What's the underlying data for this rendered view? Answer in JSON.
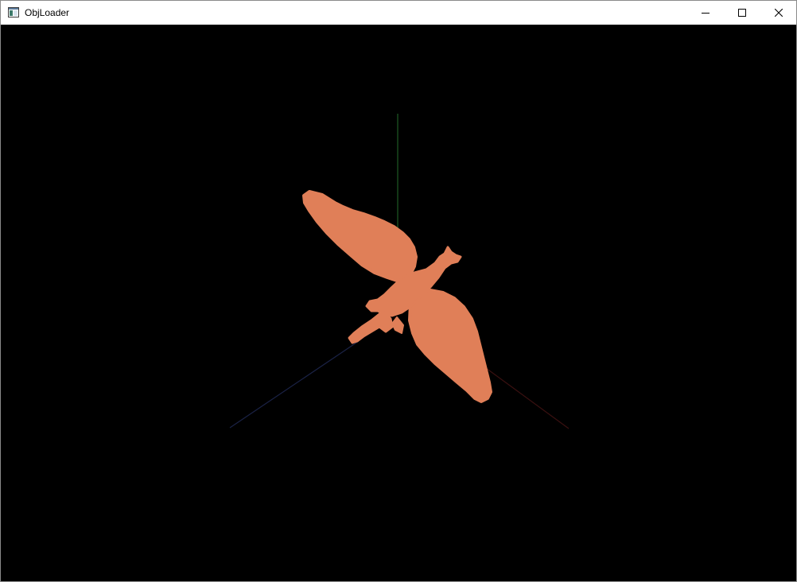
{
  "window": {
    "title": "ObjLoader"
  },
  "titlebar": {
    "icon": "app-window-icon",
    "controls": {
      "minimize_icon": "minimize-icon",
      "maximize_icon": "maximize-icon",
      "close_icon": "close-icon"
    }
  },
  "scene": {
    "background_color": "#000000",
    "model_color": "#e07f58",
    "axis_colors": {
      "x": "#3a1010",
      "y": "#1f5a26",
      "z": "#1a2246"
    },
    "model": "bird-model"
  }
}
